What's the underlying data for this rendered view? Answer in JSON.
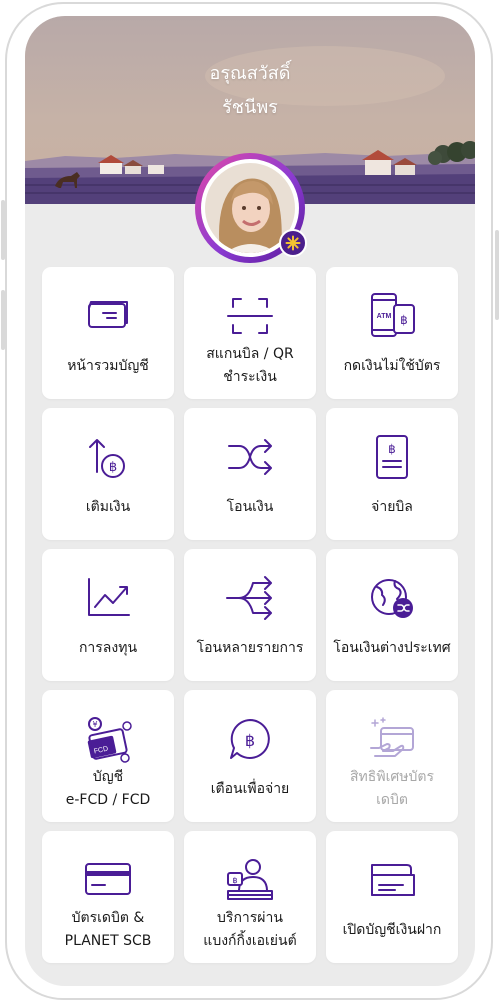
{
  "header": {
    "greeting": "อรุณสวัสดิ์",
    "user_name": "รัชนีพร"
  },
  "colors": {
    "accent": "#4a1d96",
    "disabled": "#b3a6d6",
    "tile_bg": "#ffffff",
    "screen_bg": "#ebebeb"
  },
  "menu": [
    {
      "label": "หน้ารวมบัญชี",
      "icon": "account-card-icon"
    },
    {
      "label": "สแกนบิล / QR",
      "label2": "ชำระเงิน",
      "icon": "scan-qr-icon"
    },
    {
      "label": "กดเงินไม่ใช้บัตร",
      "icon": "cardless-atm-icon"
    },
    {
      "label": "เติมเงิน",
      "icon": "top-up-icon"
    },
    {
      "label": "โอนเงิน",
      "icon": "transfer-icon"
    },
    {
      "label": "จ่ายบิล",
      "icon": "bill-payment-icon"
    },
    {
      "label": "การลงทุน",
      "icon": "investment-chart-icon"
    },
    {
      "label": "โอนหลายรายการ",
      "icon": "multi-transfer-icon"
    },
    {
      "label": "โอนเงินต่างประเทศ",
      "icon": "international-transfer-icon"
    },
    {
      "label": "บัญชี",
      "label2": "e-FCD / FCD",
      "icon": "fcd-account-icon"
    },
    {
      "label": "เตือนเพื่อจ่าย",
      "icon": "payment-reminder-icon"
    },
    {
      "label": "สิทธิพิเศษบัตร",
      "label2": "เดบิต",
      "icon": "debit-privilege-icon",
      "disabled": true
    },
    {
      "label": "บัตรเดบิต &",
      "label2": "PLANET SCB",
      "icon": "debit-card-icon"
    },
    {
      "label": "บริการผ่าน",
      "label2": "แบงก์กิ้งเอเย่นต์",
      "icon": "banking-agent-icon"
    },
    {
      "label": "เปิดบัญชีเงินฝาก",
      "icon": "open-account-icon"
    }
  ]
}
